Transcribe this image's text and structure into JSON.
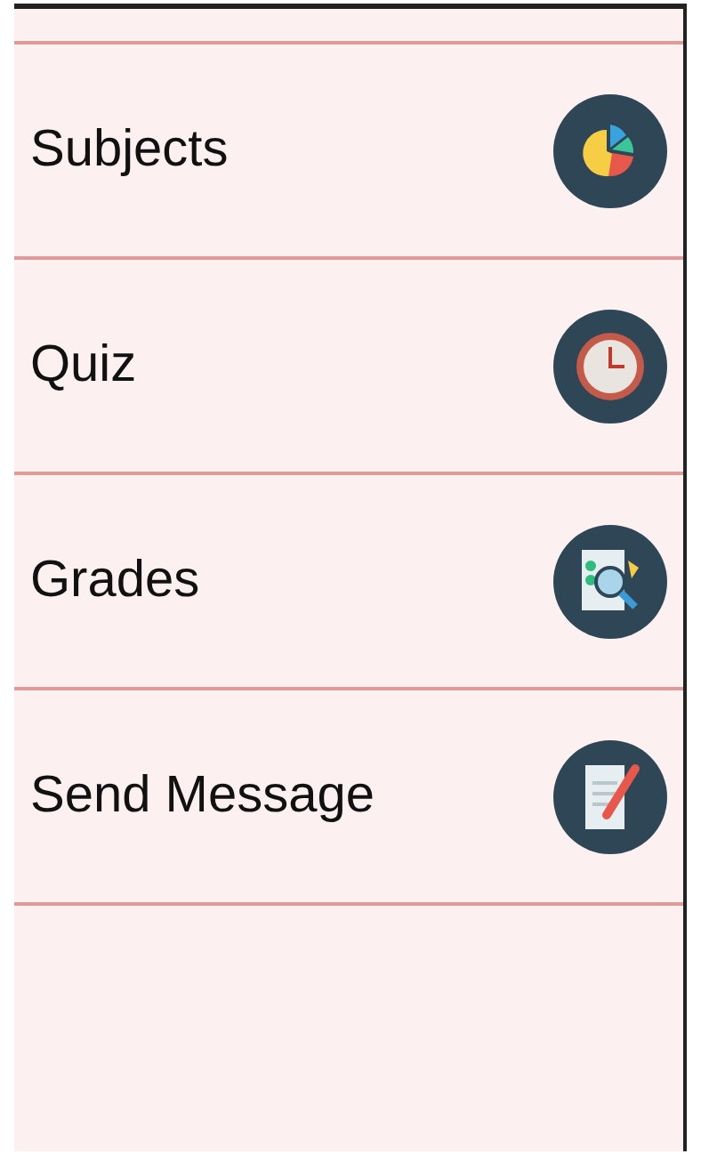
{
  "menu_items": [
    {
      "label": "Subjects",
      "kind": "chart"
    },
    {
      "label": "Quiz",
      "kind": "clock"
    },
    {
      "label": "Grades",
      "kind": "report"
    },
    {
      "label": "Send Message",
      "kind": "note"
    }
  ]
}
